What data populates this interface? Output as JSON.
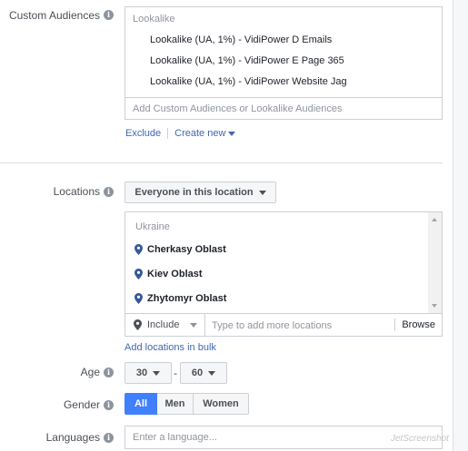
{
  "custom_audiences": {
    "label": "Custom Audiences",
    "group_header": "Lookalike",
    "items": [
      "Lookalike (UA, 1%) - VidiPower D Emails",
      "Lookalike (UA, 1%) - VidiPower E Page 365",
      "Lookalike (UA, 1%) - VidiPower Website Jag"
    ],
    "input_placeholder": "Add Custom Audiences or Lookalike Audiences",
    "exclude_label": "Exclude",
    "create_new_label": "Create new"
  },
  "locations": {
    "label": "Locations",
    "dropdown_value": "Everyone in this location",
    "country": "Ukraine",
    "items": [
      "Cherkasy Oblast",
      "Kiev Oblast",
      "Zhytomyr Oblast"
    ],
    "include_label": "Include",
    "input_placeholder": "Type to add more locations",
    "browse_label": "Browse",
    "bulk_link": "Add locations in bulk"
  },
  "age": {
    "label": "Age",
    "min": "30",
    "separator": "-",
    "max": "60"
  },
  "gender": {
    "label": "Gender",
    "options": [
      "All",
      "Men",
      "Women"
    ],
    "selected": "All"
  },
  "languages": {
    "label": "Languages",
    "input_placeholder": "Enter a language..."
  },
  "watermark": "JetScreenshot",
  "colors": {
    "link": "#4267b2",
    "active_segment": "#4080ff",
    "pin": "#365899"
  }
}
